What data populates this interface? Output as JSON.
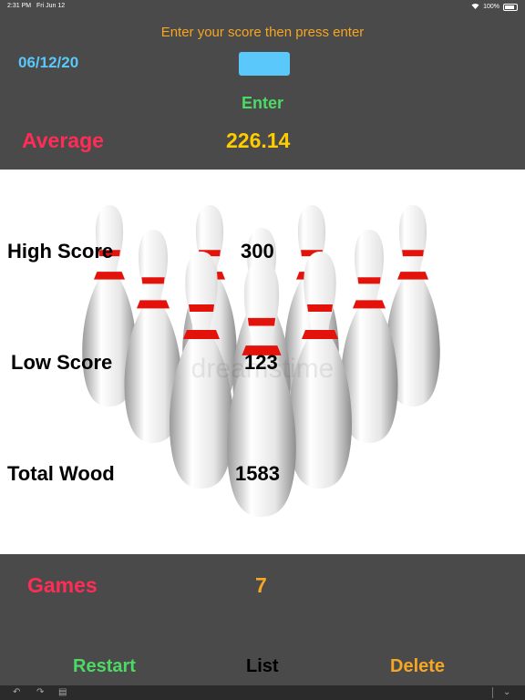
{
  "status_bar": {
    "time": "2:31 PM",
    "date": "Fri Jun 12",
    "battery": "100%"
  },
  "header": {
    "prompt": "Enter your score then press enter",
    "date": "06/12/20",
    "enter_label": "Enter"
  },
  "average": {
    "label": "Average",
    "value": "226.14"
  },
  "stats": {
    "high_label": "High Score",
    "high_value": "300",
    "low_label": "Low Score",
    "low_value": "123",
    "wood_label": "Total Wood",
    "wood_value": "1583"
  },
  "games": {
    "label": "Games",
    "value": "7"
  },
  "actions": {
    "restart": "Restart",
    "list": "List",
    "delete": "Delete"
  },
  "watermark": "dreamstime",
  "colors": {
    "accent_red": "#ff2d55",
    "accent_orange": "#f5a623",
    "accent_green": "#4cd964",
    "accent_blue": "#5ac8fa",
    "accent_yellow": "#ffcc00"
  },
  "icons": {
    "undo": "undo-icon",
    "redo": "redo-icon",
    "paste": "paste-icon",
    "dismiss_keyboard": "keyboard-dismiss-icon"
  }
}
